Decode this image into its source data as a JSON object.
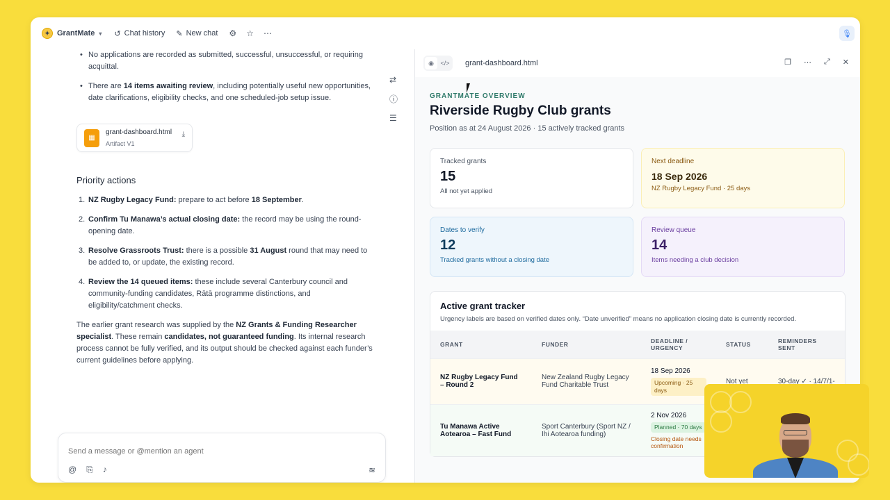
{
  "topbar": {
    "app_name": "GrantMate",
    "chat_history": "Chat history",
    "new_chat": "New chat"
  },
  "chat": {
    "bullets": [
      {
        "text": "No applications are recorded as submitted, successful, unsuccessful, or requiring acquittal."
      },
      {
        "pre": "There are ",
        "bold": "14 items awaiting review",
        "post": ", including potentially useful new opportunities, date clarifications, eligibility checks, and one scheduled-job setup issue."
      }
    ],
    "artifact": {
      "name": "grant-dashboard.html",
      "sub": "Artifact V1"
    },
    "priority_heading": "Priority actions",
    "actions": [
      {
        "num": "1.",
        "bold": "NZ Rugby Legacy Fund:",
        "text": " prepare to act before ",
        "bold2": "18 September",
        "text2": "."
      },
      {
        "num": "2.",
        "bold": "Confirm Tu Manawa’s actual closing date:",
        "text": " the record may be using the round-opening date.",
        "bold2": "",
        "text2": ""
      },
      {
        "num": "3.",
        "bold": "Resolve Grassroots Trust:",
        "text": " there is a possible ",
        "bold2": "31 August",
        "text2": " round that may need to be added to, or update, the existing record."
      },
      {
        "num": "4.",
        "bold": "Review the 14 queued items:",
        "text": " these include several Canterbury council and community-funding candidates, Rātā programme distinctions, and eligibility/catchment checks.",
        "bold2": "",
        "text2": ""
      }
    ],
    "closing": {
      "p1": "The earlier grant research was supplied by the ",
      "b1": "NZ Grants & Funding Researcher specialist",
      "p2": ". These remain ",
      "b2": "candidates, not guaranteed funding",
      "p3": ". Its internal research process cannot be fully verified, and its output should be checked against each funder’s current guidelines before applying."
    },
    "composer_placeholder": "Send a message or @mention an agent"
  },
  "artifact_panel": {
    "filename": "grant-dashboard.html",
    "eyebrow": "GRANTMATE OVERVIEW",
    "title": "Riverside Rugby Club grants",
    "subtitle": "Position as at 24 August 2026 · 15 actively tracked grants",
    "cards": [
      {
        "label": "Tracked grants",
        "value": "15",
        "sub": "All not yet applied"
      },
      {
        "label": "Next deadline",
        "value": "18 Sep 2026",
        "sub": "NZ Rugby Legacy Fund · 25 days"
      },
      {
        "label": "Dates to verify",
        "value": "12",
        "sub": "Tracked grants without a closing date"
      },
      {
        "label": "Review queue",
        "value": "14",
        "sub": "Items needing a club decision"
      }
    ],
    "tracker": {
      "title": "Active grant tracker",
      "note": "Urgency labels are based on verified dates only. “Date unverified” means no application closing date is currently recorded.",
      "headers": [
        "GRANT",
        "FUNDER",
        "DEADLINE / URGENCY",
        "STATUS",
        "REMINDERS SENT"
      ],
      "rows": [
        {
          "grant": "NZ Rugby Legacy Fund – Round 2",
          "funder": "New Zealand Rugby Legacy Fund Charitable Trust",
          "date": "18 Sep 2026",
          "badge": "Upcoming · 25 days",
          "note": "",
          "status": "Not yet",
          "reminders": "30-day ✓ · 14/7/1-"
        },
        {
          "grant": "Tu Manawa Active Aotearoa – Fast Fund",
          "funder": "Sport Canterbury (Sport NZ / Ihi Aotearoa funding)",
          "date": "2 Nov 2026",
          "badge": "Planned · 70 days",
          "note": "Closing date needs confirmation",
          "status": "",
          "reminders": ""
        }
      ]
    }
  },
  "colors": {
    "background": "#f9dd3c",
    "eyebrow": "#2f7a6a"
  }
}
